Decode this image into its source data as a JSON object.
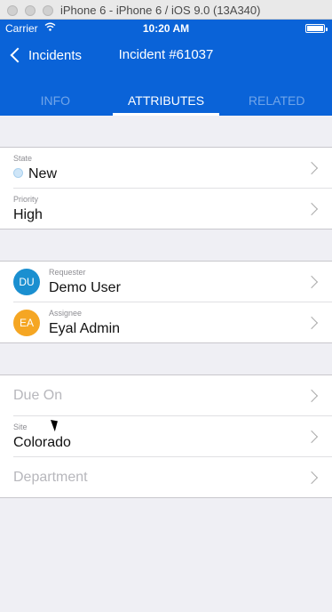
{
  "simulator": {
    "title": "iPhone 6 - iPhone 6 / iOS 9.0 (13A340)"
  },
  "status_bar": {
    "carrier": "Carrier",
    "time": "10:20 AM"
  },
  "nav": {
    "back_label": "Incidents",
    "title": "Incident #61037"
  },
  "tabs": [
    {
      "label": "INFO",
      "active": false
    },
    {
      "label": "ATTRIBUTES",
      "active": true
    },
    {
      "label": "RELATED",
      "active": false
    }
  ],
  "groups": {
    "state": {
      "label": "State",
      "value": "New"
    },
    "priority": {
      "label": "Priority",
      "value": "High"
    },
    "requester": {
      "label": "Requester",
      "initials": "DU",
      "name": "Demo User",
      "color": "#1a8fd0"
    },
    "assignee": {
      "label": "Assignee",
      "initials": "EA",
      "name": "Eyal Admin",
      "color": "#f5a623"
    },
    "due_on": {
      "placeholder": "Due On"
    },
    "site": {
      "label": "Site",
      "value": "Colorado"
    },
    "department": {
      "placeholder": "Department"
    }
  },
  "colors": {
    "accent": "#0a63d8",
    "background": "#efeff4"
  }
}
